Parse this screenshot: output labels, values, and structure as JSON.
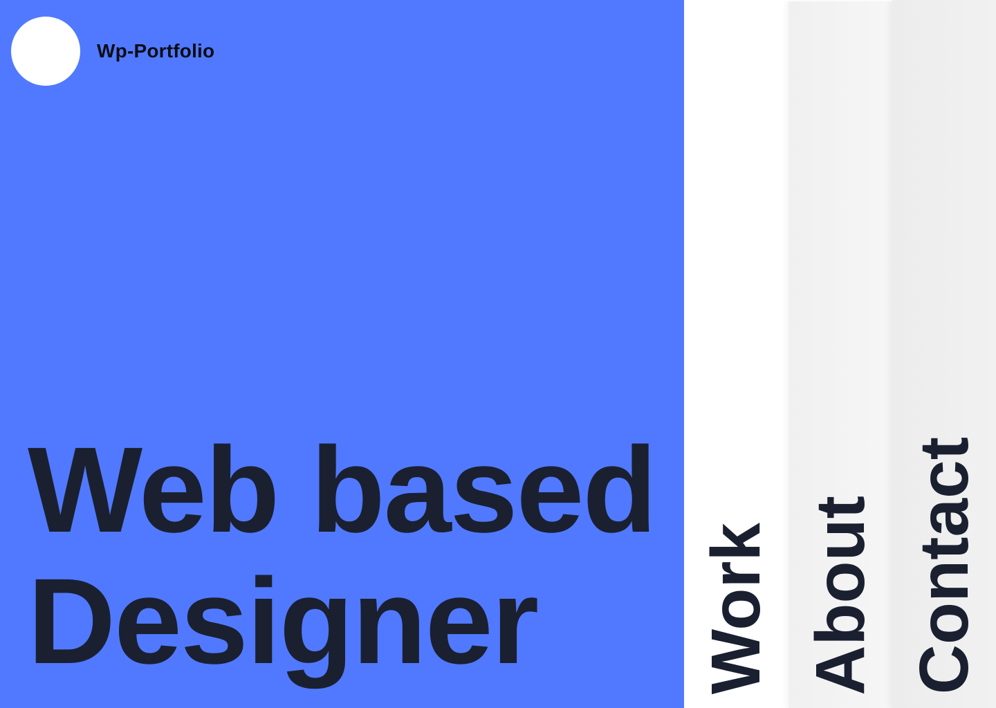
{
  "brand": {
    "name": "Wp-Portfolio"
  },
  "hero": {
    "line1": "Web based",
    "line2": "Designer"
  },
  "nav": {
    "items": [
      {
        "label": "Work"
      },
      {
        "label": "About"
      },
      {
        "label": "Contact"
      }
    ]
  },
  "colors": {
    "hero_background": "#5179ff",
    "headline_text": "#1a2030",
    "logo_fill": "#ffffff"
  }
}
